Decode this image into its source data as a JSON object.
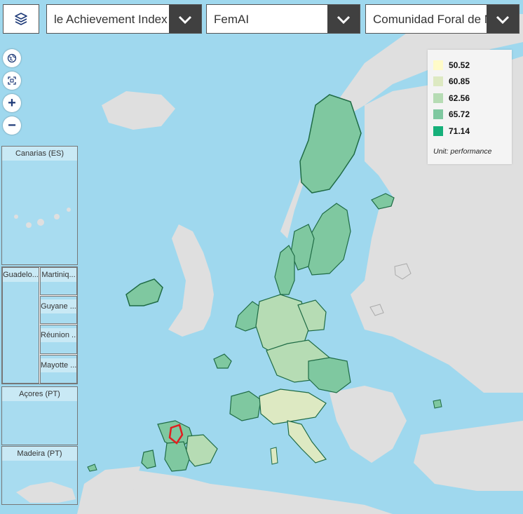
{
  "toolbar": {
    "layers_icon": "layers-icon",
    "indicator_select": {
      "value": "Female Achievement Index",
      "visible_text": "le Achievement Index"
    },
    "measure_select": {
      "value": "FemAI"
    },
    "region_select": {
      "value": "Comunidad Foral de Navarra",
      "visible_text": "Comunidad Foral de N"
    }
  },
  "map_controls": {
    "globe_icon": "globe-icon",
    "fit_icon": "fit-extent-icon",
    "zoom_in": "+",
    "zoom_out": "−"
  },
  "insets": {
    "canarias": "Canarias (ES)",
    "guadeloupe": "Guadelo...",
    "martinique": "Martiniq...",
    "guyane": "Guyane ...",
    "reunion": "Réunion ...",
    "mayotte": "Mayotte ...",
    "acores": "Açores (PT)",
    "madeira": "Madeira (PT)"
  },
  "legend": {
    "classes": [
      {
        "value": "50.52",
        "color": "#fffbc8"
      },
      {
        "value": "60.85",
        "color": "#dde9c2"
      },
      {
        "value": "62.56",
        "color": "#b6dcb4"
      },
      {
        "value": "65.72",
        "color": "#7fc8a0"
      },
      {
        "value": "71.14",
        "color": "#16b07a"
      }
    ],
    "unit": "Unit: performance"
  },
  "colors": {
    "sea": "#9fd8ee",
    "land_nodata": "#dfdfdf",
    "region_border": "#1f6b45",
    "selected_border": "#e02020"
  }
}
